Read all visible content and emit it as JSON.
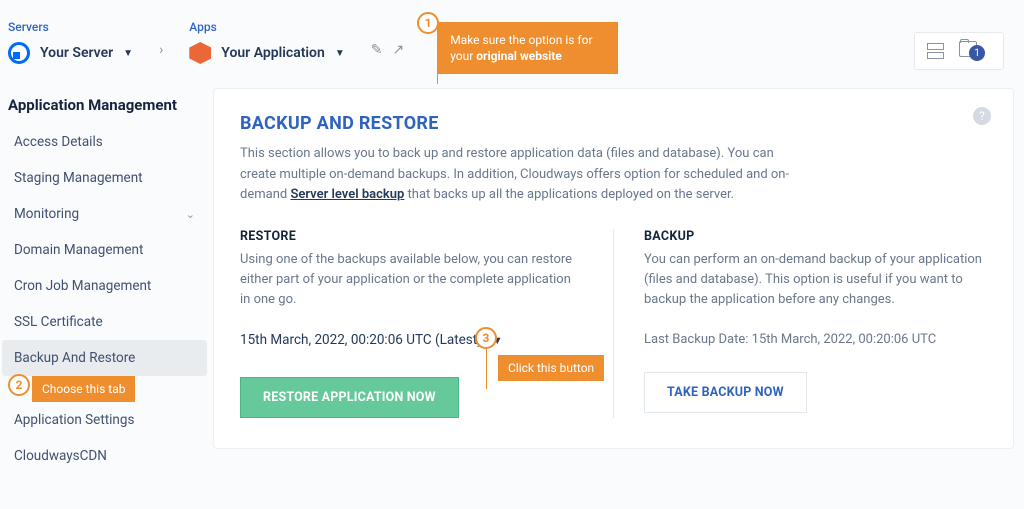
{
  "top": {
    "servers_label": "Servers",
    "server_name": "Your Server",
    "apps_label": "Apps",
    "app_name": "Your Application",
    "badge_count": "1"
  },
  "callouts": {
    "c1_num": "1",
    "c1_text_a": "Make sure the option is for your ",
    "c1_text_b": "original website",
    "c2_num": "2",
    "c2_text": "Choose this tab",
    "c3_num": "3",
    "c3_text": "Click this button"
  },
  "sidebar": {
    "heading": "Application Management",
    "items": {
      "access": "Access Details",
      "staging": "Staging Management",
      "monitoring": "Monitoring",
      "domain": "Domain Management",
      "cron": "Cron Job Management",
      "ssl": "SSL Certificate",
      "backup": "Backup And Restore",
      "appset": "Application Settings",
      "cdn": "CloudwaysCDN"
    }
  },
  "main": {
    "title": "BACKUP AND RESTORE",
    "desc_a": "This section allows you to back up and restore application data (files and database). You can create multiple on-demand backups. In addition, Cloudways offers option for scheduled and on-demand  ",
    "desc_link": "Server level backup",
    "desc_b": "  that backs up all the applications deployed on the server.",
    "restore": {
      "heading": "RESTORE",
      "text": "Using one of the backups available below, you can restore either part of your application or the complete application in one go.",
      "selected": "15th March, 2022, 00:20:06 UTC (Latest)",
      "button": "RESTORE APPLICATION NOW"
    },
    "backup": {
      "heading": "BACKUP",
      "text": "You can perform an on-demand backup of your application (files and database). This option is useful if you want to backup the application before any changes.",
      "last_label": "Last Backup Date: ",
      "last_value": "15th March, 2022, 00:20:06 UTC",
      "button": "TAKE BACKUP NOW"
    }
  }
}
